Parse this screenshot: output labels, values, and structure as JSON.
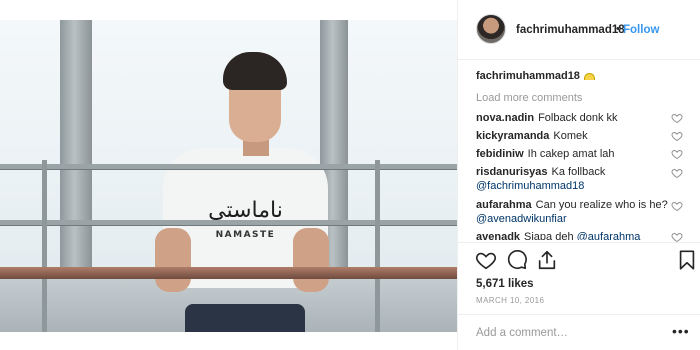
{
  "post": {
    "username": "fachrimuhammad18",
    "follow_label": "Follow",
    "separator": "•",
    "shirt_text_arabic": "ناماستي",
    "shirt_text_latin": "NAMASTE"
  },
  "caption": {
    "username": "fachrimuhammad18"
  },
  "load_more_label": "Load more comments",
  "comments": [
    {
      "username": "nova.nadin",
      "text": "Folback donk kk"
    },
    {
      "username": "kickyramanda",
      "text": "Komek"
    },
    {
      "username": "febidiniw",
      "text": "Ih cakep amat lah"
    },
    {
      "username": "risdanurisyas",
      "text": "Ka follback",
      "mention": "@fachrimuhammad18"
    },
    {
      "username": "aufarahma",
      "text": "Can you realize who is he?",
      "mention": "@avenadwikunfiar"
    },
    {
      "username": "avenadk",
      "text": "Siapa deh",
      "mention": "@aufarahma"
    }
  ],
  "likes_label": "5,671 likes",
  "date_label": "MARCH 10, 2016",
  "add_comment": {
    "placeholder": "Add a comment…"
  },
  "more_options_label": "•••",
  "colors": {
    "link": "#3897f0",
    "mention": "#003569",
    "muted": "#999999",
    "text": "#262626"
  },
  "icons": [
    "heart-icon",
    "comment-icon",
    "share-icon",
    "bookmark-icon"
  ]
}
